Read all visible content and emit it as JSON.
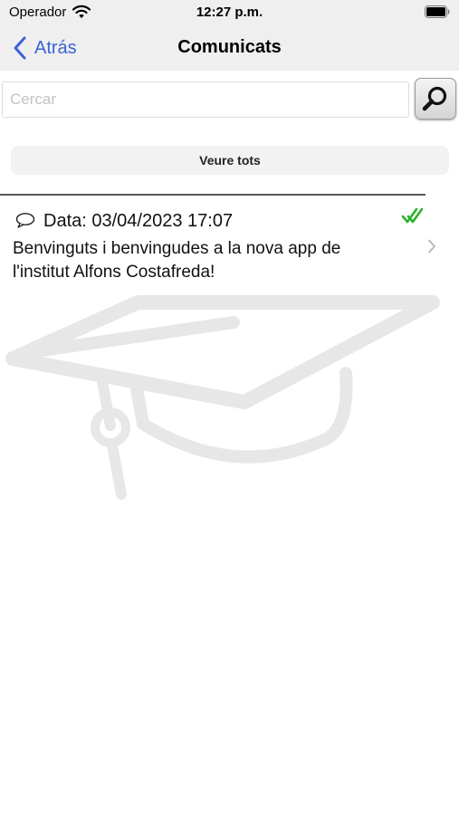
{
  "status_bar": {
    "carrier": "Operador",
    "time": "12:27 p.m."
  },
  "nav": {
    "back_label": "Atrás",
    "title": "Comunicats"
  },
  "search": {
    "placeholder": "Cercar",
    "value": ""
  },
  "filter": {
    "show_all_label": "Veure tots"
  },
  "messages": [
    {
      "date_text": "Data: 03/04/2023 17:07",
      "body": "Benvinguts i benvingudes a la nova app de l'institut Alfons Costafreda!",
      "read": true
    }
  ],
  "colors": {
    "accent": "#3a63d6",
    "read_check": "#2db32d",
    "bars": "#efeff0"
  }
}
